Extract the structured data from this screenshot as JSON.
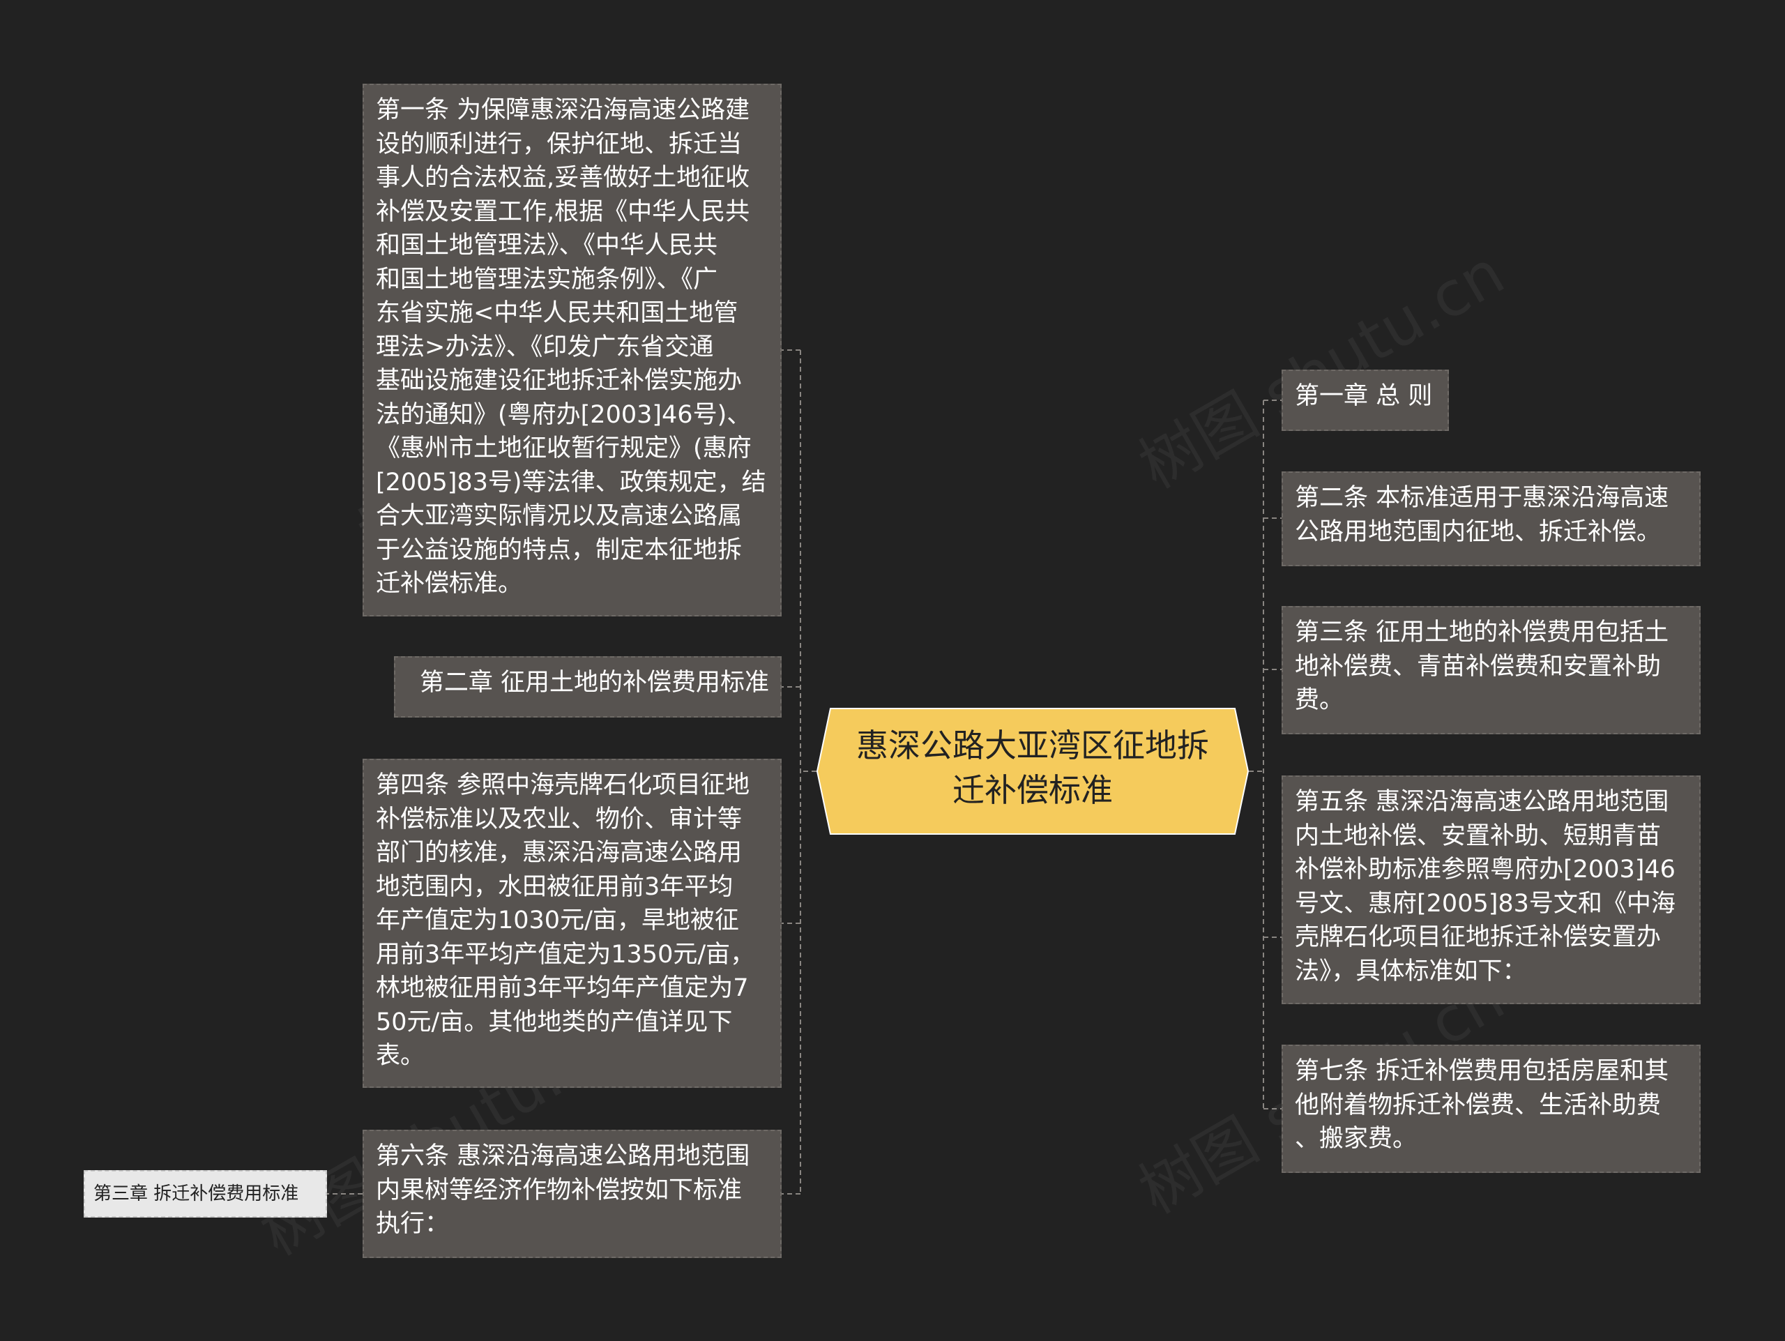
{
  "colors": {
    "background": "#222222",
    "node_fill": "#575350",
    "center_fill": "#f5cb5c",
    "connector": "#8a8682"
  },
  "watermark": "树图 shutu.cn",
  "center": {
    "title": "惠深公路大亚湾区征地拆\n迁补偿标准"
  },
  "left": [
    {
      "text": "第一条 为保障惠深沿海高速公路建\n设的顺利进行，保护征地、拆迁当\n事人的合法权益,妥善做好土地征收\n补偿及安置工作,根据《中华人民共\n和国土地管理法》、《中华人民共\n和国土地管理法实施条例》、《广\n东省实施<中华人民共和国土地管\n理法>办法》、《印发广东省交通\n基础设施建设征地拆迁补偿实施办\n法的通知》(粤府办[2003]46号)、\n《惠州市土地征收暂行规定》(惠府\n[2005]83号)等法律、政策规定，结\n合大亚湾实际情况以及高速公路属\n于公益设施的特点，制定本征地拆\n迁补偿标准。"
    },
    {
      "text": "第二章 征用土地的补偿费用标准"
    },
    {
      "text": "第四条 参照中海壳牌石化项目征地\n补偿标准以及农业、物价、审计等\n部门的核准，惠深沿海高速公路用\n地范围内，水田被征用前3年平均\n年产值定为1030元/亩，旱地被征\n用前3年平均产值定为1350元/亩，\n林地被征用前3年平均年产值定为7\n50元/亩。其他地类的产值详见下\n表。"
    },
    {
      "text": "第六条 惠深沿海高速公路用地范围\n内果树等经济作物补偿按如下标准\n执行："
    }
  ],
  "left_sub": {
    "text": "第三章 拆迁补偿费用标准"
  },
  "right": [
    {
      "text": "第一章 总 则"
    },
    {
      "text": "第二条 本标准适用于惠深沿海高速\n公路用地范围内征地、拆迁补偿。"
    },
    {
      "text": "第三条 征用土地的补偿费用包括土\n地补偿费、青苗补偿费和安置补助\n费。"
    },
    {
      "text": "第五条 惠深沿海高速公路用地范围\n内土地补偿、安置补助、短期青苗\n补偿补助标准参照粤府办[2003]46\n号文、惠府[2005]83号文和《中海\n壳牌石化项目征地拆迁补偿安置办\n法》，具体标准如下："
    },
    {
      "text": "第七条 拆迁补偿费用包括房屋和其\n他附着物拆迁补偿费、生活补助费\n、搬家费。"
    }
  ]
}
